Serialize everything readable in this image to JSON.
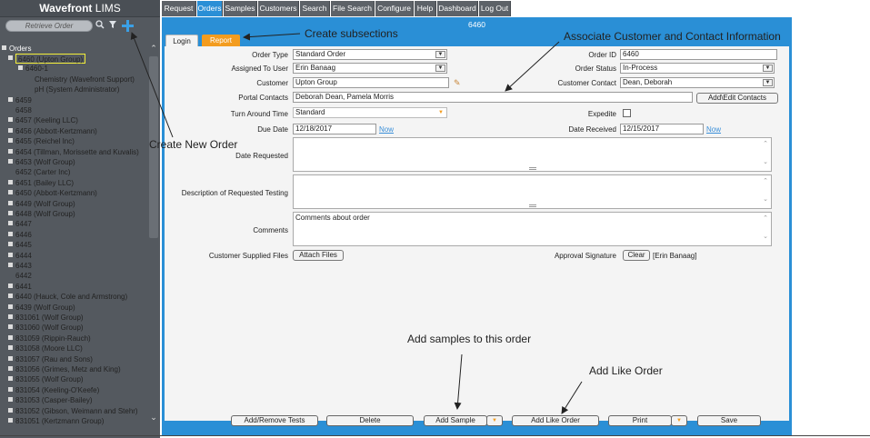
{
  "app": {
    "brand": "Wavefront",
    "brand_suffix": "LIMS"
  },
  "search": {
    "placeholder": "Retrieve Order"
  },
  "toolbar_icons": [
    "search-icon",
    "filter-icon",
    "plus-icon"
  ],
  "nav": {
    "tabs": [
      {
        "label": "Request"
      },
      {
        "label": "Orders",
        "active": true
      },
      {
        "label": "Samples"
      },
      {
        "label": "Customers"
      },
      {
        "label": "Search"
      },
      {
        "label": "File Search"
      },
      {
        "label": "Configure"
      },
      {
        "label": "Help"
      },
      {
        "label": "Dashboard"
      },
      {
        "label": "Log Out"
      }
    ]
  },
  "tree": {
    "root": "Orders",
    "items": [
      {
        "label": "6460 (Upton Group)",
        "color": "yellow",
        "level": 1,
        "selected": true
      },
      {
        "label": "6460-1",
        "color": "yellow",
        "level": 2
      },
      {
        "label": "Chemistry (Wavefront Support)",
        "color": "yellow",
        "level": 3
      },
      {
        "label": "pH (System Administrator)",
        "color": "yellow",
        "level": 3
      },
      {
        "label": "6459",
        "color": "white",
        "level": 1
      },
      {
        "label": "6458",
        "color": "white",
        "level": 1,
        "noexp": true
      },
      {
        "label": "6457 (Keeling LLC)",
        "color": "green",
        "level": 1
      },
      {
        "label": "6456 (Abbott-Kertzmann)",
        "color": "green",
        "level": 1
      },
      {
        "label": "6455 (Reichel Inc)",
        "color": "green",
        "level": 1
      },
      {
        "label": "6454 (Tillman, Morissette and Kuvalis)",
        "color": "green",
        "level": 1
      },
      {
        "label": "6453 (Wolf Group)",
        "color": "white",
        "level": 1
      },
      {
        "label": "6452 (Carter Inc)",
        "color": "green",
        "level": 1,
        "noexp": true
      },
      {
        "label": "6451 (Bailey LLC)",
        "color": "green",
        "level": 1
      },
      {
        "label": "6450 (Abbott-Kertzmann)",
        "color": "green",
        "level": 1
      },
      {
        "label": "6449 (Wolf Group)",
        "color": "green",
        "level": 1
      },
      {
        "label": "6448 (Wolf Group)",
        "color": "white",
        "level": 1
      },
      {
        "label": "6447",
        "color": "white",
        "level": 1
      },
      {
        "label": "6446",
        "color": "white",
        "level": 1
      },
      {
        "label": "6445",
        "color": "white",
        "level": 1
      },
      {
        "label": "6444",
        "color": "white",
        "level": 1
      },
      {
        "label": "6443",
        "color": "white",
        "level": 1
      },
      {
        "label": "6442",
        "color": "white",
        "level": 1,
        "noexp": true
      },
      {
        "label": "6441",
        "color": "white",
        "level": 1
      },
      {
        "label": "6440 (Hauck, Cole and Armstrong)",
        "color": "white",
        "level": 1
      },
      {
        "label": "6439 (Wolf Group)",
        "color": "white",
        "level": 1
      },
      {
        "label": "831061 (Wolf Group)",
        "color": "white",
        "level": 1
      },
      {
        "label": "831060 (Wolf Group)",
        "color": "white",
        "level": 1
      },
      {
        "label": "831059 (Rippin-Rauch)",
        "color": "green",
        "level": 1
      },
      {
        "label": "831058 (Moore LLC)",
        "color": "white",
        "level": 1
      },
      {
        "label": "831057 (Rau and Sons)",
        "color": "white",
        "level": 1
      },
      {
        "label": "831056 (Grimes, Metz and King)",
        "color": "white",
        "level": 1
      },
      {
        "label": "831055 (Wolf Group)",
        "color": "white",
        "level": 1
      },
      {
        "label": "831054 (Keeling-O'Keefe)",
        "color": "white",
        "level": 1
      },
      {
        "label": "831053 (Casper-Bailey)",
        "color": "white",
        "level": 1
      },
      {
        "label": "831052 (Gibson, Weimann and Stehr)",
        "color": "white",
        "level": 1
      },
      {
        "label": "831051 (Kertzmann Group)",
        "color": "white",
        "level": 1
      }
    ]
  },
  "order": {
    "header": "6460",
    "subtabs": {
      "login": "Login",
      "report": "Report"
    },
    "labels": {
      "order_type": "Order Type",
      "assigned_to": "Assigned To User",
      "customer": "Customer",
      "portal_contacts": "Portal Contacts",
      "turn_around": "Turn Around Time",
      "due_date": "Due Date",
      "date_requested": "Date Requested",
      "description": "Description of Requested Testing",
      "comments": "Comments",
      "customer_files": "Customer Supplied Files",
      "order_id": "Order ID",
      "order_status": "Order Status",
      "customer_contact": "Customer Contact",
      "expedite": "Expedite",
      "date_received": "Date Received",
      "approval_signature": "Approval Signature"
    },
    "values": {
      "order_type": "Standard Order",
      "assigned_to": "Erin Banaag",
      "customer": "Upton Group",
      "portal_contacts": "Deborah Dean, Pamela Morris",
      "turn_around": "Standard",
      "due_date": "12/18/2017",
      "date_requested": "",
      "description": "",
      "comments": "Comments about order",
      "order_id": "6460",
      "order_status": "In-Process",
      "customer_contact": "Dean, Deborah",
      "date_received": "12/15/2017",
      "approval_signature": "[Erin Banaag]"
    },
    "links": {
      "now": "Now"
    },
    "buttons": {
      "add_edit_contacts": "Add\\Edit Contacts",
      "attach_files": "Attach Files",
      "clear": "Clear"
    },
    "bottom": {
      "add_remove_tests": "Add/Remove Tests",
      "delete": "Delete",
      "add_sample": "Add Sample",
      "add_like_order": "Add Like Order",
      "print": "Print",
      "save": "Save"
    }
  },
  "annotations": {
    "create_subsections": "Create subsections",
    "associate_customer": "Associate Customer and Contact Information",
    "create_new_order": "Create New Order",
    "add_samples": "Add samples to this order",
    "add_like_order": "Add Like Order"
  },
  "colors": {
    "accent": "#2a8fd6",
    "report_tab": "#f39c1f",
    "tree_green": "#34e67a",
    "tree_yellow": "#f2ee3a",
    "sidebar": "#54595f"
  }
}
